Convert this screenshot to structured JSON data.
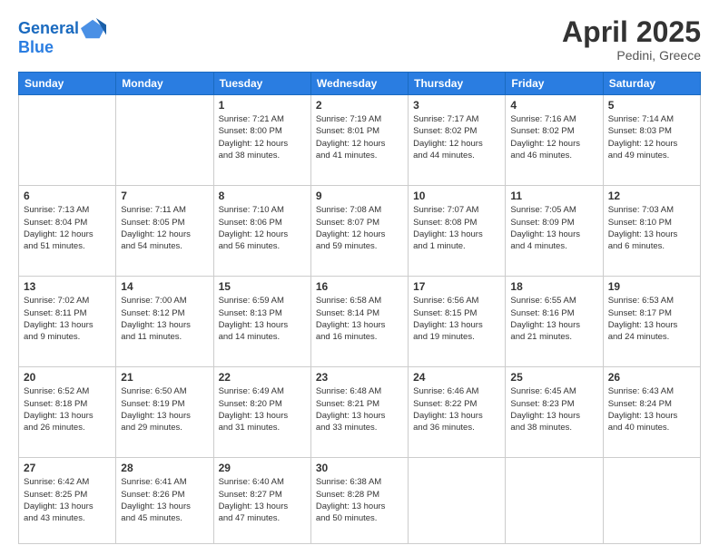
{
  "header": {
    "logo_line1": "General",
    "logo_line2": "Blue",
    "month": "April 2025",
    "location": "Pedini, Greece"
  },
  "weekdays": [
    "Sunday",
    "Monday",
    "Tuesday",
    "Wednesday",
    "Thursday",
    "Friday",
    "Saturday"
  ],
  "weeks": [
    [
      {
        "day": "",
        "info": ""
      },
      {
        "day": "",
        "info": ""
      },
      {
        "day": "1",
        "info": "Sunrise: 7:21 AM\nSunset: 8:00 PM\nDaylight: 12 hours\nand 38 minutes."
      },
      {
        "day": "2",
        "info": "Sunrise: 7:19 AM\nSunset: 8:01 PM\nDaylight: 12 hours\nand 41 minutes."
      },
      {
        "day": "3",
        "info": "Sunrise: 7:17 AM\nSunset: 8:02 PM\nDaylight: 12 hours\nand 44 minutes."
      },
      {
        "day": "4",
        "info": "Sunrise: 7:16 AM\nSunset: 8:02 PM\nDaylight: 12 hours\nand 46 minutes."
      },
      {
        "day": "5",
        "info": "Sunrise: 7:14 AM\nSunset: 8:03 PM\nDaylight: 12 hours\nand 49 minutes."
      }
    ],
    [
      {
        "day": "6",
        "info": "Sunrise: 7:13 AM\nSunset: 8:04 PM\nDaylight: 12 hours\nand 51 minutes."
      },
      {
        "day": "7",
        "info": "Sunrise: 7:11 AM\nSunset: 8:05 PM\nDaylight: 12 hours\nand 54 minutes."
      },
      {
        "day": "8",
        "info": "Sunrise: 7:10 AM\nSunset: 8:06 PM\nDaylight: 12 hours\nand 56 minutes."
      },
      {
        "day": "9",
        "info": "Sunrise: 7:08 AM\nSunset: 8:07 PM\nDaylight: 12 hours\nand 59 minutes."
      },
      {
        "day": "10",
        "info": "Sunrise: 7:07 AM\nSunset: 8:08 PM\nDaylight: 13 hours\nand 1 minute."
      },
      {
        "day": "11",
        "info": "Sunrise: 7:05 AM\nSunset: 8:09 PM\nDaylight: 13 hours\nand 4 minutes."
      },
      {
        "day": "12",
        "info": "Sunrise: 7:03 AM\nSunset: 8:10 PM\nDaylight: 13 hours\nand 6 minutes."
      }
    ],
    [
      {
        "day": "13",
        "info": "Sunrise: 7:02 AM\nSunset: 8:11 PM\nDaylight: 13 hours\nand 9 minutes."
      },
      {
        "day": "14",
        "info": "Sunrise: 7:00 AM\nSunset: 8:12 PM\nDaylight: 13 hours\nand 11 minutes."
      },
      {
        "day": "15",
        "info": "Sunrise: 6:59 AM\nSunset: 8:13 PM\nDaylight: 13 hours\nand 14 minutes."
      },
      {
        "day": "16",
        "info": "Sunrise: 6:58 AM\nSunset: 8:14 PM\nDaylight: 13 hours\nand 16 minutes."
      },
      {
        "day": "17",
        "info": "Sunrise: 6:56 AM\nSunset: 8:15 PM\nDaylight: 13 hours\nand 19 minutes."
      },
      {
        "day": "18",
        "info": "Sunrise: 6:55 AM\nSunset: 8:16 PM\nDaylight: 13 hours\nand 21 minutes."
      },
      {
        "day": "19",
        "info": "Sunrise: 6:53 AM\nSunset: 8:17 PM\nDaylight: 13 hours\nand 24 minutes."
      }
    ],
    [
      {
        "day": "20",
        "info": "Sunrise: 6:52 AM\nSunset: 8:18 PM\nDaylight: 13 hours\nand 26 minutes."
      },
      {
        "day": "21",
        "info": "Sunrise: 6:50 AM\nSunset: 8:19 PM\nDaylight: 13 hours\nand 29 minutes."
      },
      {
        "day": "22",
        "info": "Sunrise: 6:49 AM\nSunset: 8:20 PM\nDaylight: 13 hours\nand 31 minutes."
      },
      {
        "day": "23",
        "info": "Sunrise: 6:48 AM\nSunset: 8:21 PM\nDaylight: 13 hours\nand 33 minutes."
      },
      {
        "day": "24",
        "info": "Sunrise: 6:46 AM\nSunset: 8:22 PM\nDaylight: 13 hours\nand 36 minutes."
      },
      {
        "day": "25",
        "info": "Sunrise: 6:45 AM\nSunset: 8:23 PM\nDaylight: 13 hours\nand 38 minutes."
      },
      {
        "day": "26",
        "info": "Sunrise: 6:43 AM\nSunset: 8:24 PM\nDaylight: 13 hours\nand 40 minutes."
      }
    ],
    [
      {
        "day": "27",
        "info": "Sunrise: 6:42 AM\nSunset: 8:25 PM\nDaylight: 13 hours\nand 43 minutes."
      },
      {
        "day": "28",
        "info": "Sunrise: 6:41 AM\nSunset: 8:26 PM\nDaylight: 13 hours\nand 45 minutes."
      },
      {
        "day": "29",
        "info": "Sunrise: 6:40 AM\nSunset: 8:27 PM\nDaylight: 13 hours\nand 47 minutes."
      },
      {
        "day": "30",
        "info": "Sunrise: 6:38 AM\nSunset: 8:28 PM\nDaylight: 13 hours\nand 50 minutes."
      },
      {
        "day": "",
        "info": ""
      },
      {
        "day": "",
        "info": ""
      },
      {
        "day": "",
        "info": ""
      }
    ]
  ]
}
